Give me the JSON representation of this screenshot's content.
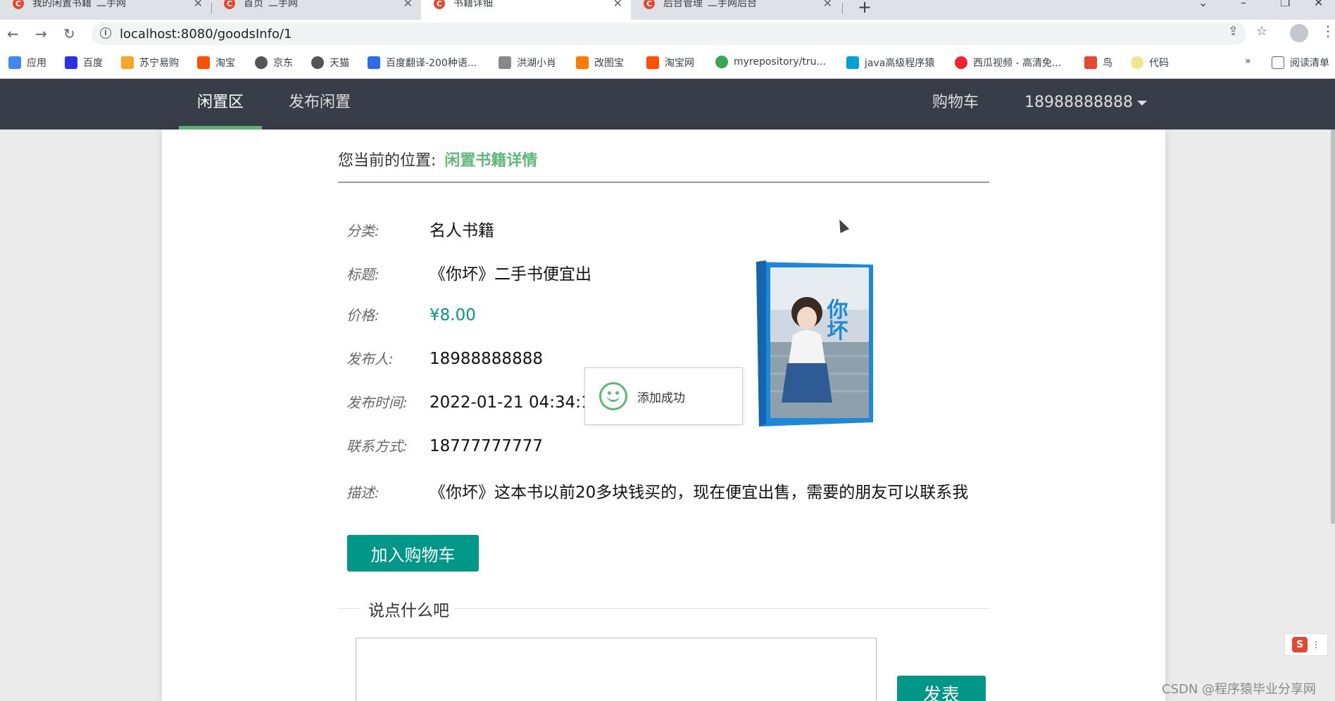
{
  "browser": {
    "tabs": [
      {
        "title": "我的闲置书籍_二手网"
      },
      {
        "title": "首页_二手网"
      },
      {
        "title": "书籍详细"
      },
      {
        "title": "后台管理_二手网后台"
      }
    ],
    "new_tab": "+",
    "url": "localhost:8080/goodsInfo/1",
    "bookmarks": [
      {
        "label": "应用",
        "color": "#4285f4"
      },
      {
        "label": "百度",
        "color": "#2932e1"
      },
      {
        "label": "苏宁易购",
        "color": "#f5a623"
      },
      {
        "label": "淘宝",
        "color": "#ff5000"
      },
      {
        "label": "京东",
        "color": "#555555"
      },
      {
        "label": "天猫",
        "color": "#555555"
      },
      {
        "label": "百度翻译-200种语...",
        "color": "#2b6de5"
      },
      {
        "label": "洪湖小肖",
        "color": "#888888"
      },
      {
        "label": "改图宝",
        "color": "#ff7a00"
      },
      {
        "label": "淘宝网",
        "color": "#ff5000"
      },
      {
        "label": "myrepository/tru...",
        "color": "#34a853"
      },
      {
        "label": "java高级程序猿",
        "color": "#00a1d6"
      },
      {
        "label": "西瓜视频 - 高清免...",
        "color": "#f5222d"
      },
      {
        "label": "鸟",
        "color": "#e8472f"
      },
      {
        "label": "代码",
        "color": "#f0e68c"
      }
    ],
    "more": "»",
    "reading_list": "阅读清单"
  },
  "nav": {
    "left": [
      "闲置区",
      "发布闲置"
    ],
    "cart": "购物车",
    "user": "18988888888"
  },
  "breadcrumb": {
    "prefix": "您当前的位置:",
    "current": "闲置书籍详情"
  },
  "details": [
    {
      "label": "分类:",
      "value": "名人书籍"
    },
    {
      "label": "标题:",
      "value": "《你坏》二手书便宜出"
    },
    {
      "label": "价格:",
      "value": "¥8.00"
    },
    {
      "label": "发布人:",
      "value": "18988888888"
    },
    {
      "label": "发布时间:",
      "value": "2022-01-21 04:34:19"
    },
    {
      "label": "联系方式:",
      "value": "18777777777"
    },
    {
      "label": "描述:",
      "value": "《你坏》这本书以前20多块钱买的，现在便宜出售，需要的朋友可以联系我"
    }
  ],
  "book_cover_text": "你坏",
  "toast": "添加成功",
  "add_cart_button": "加入购物车",
  "comment_legend": "说点什么吧",
  "post_button": "发表",
  "watermark": "CSDN @程序猿毕业分享网",
  "colors": {
    "accent": "#009688",
    "nav_bg": "#393d49",
    "highlight": "#5fb878"
  }
}
